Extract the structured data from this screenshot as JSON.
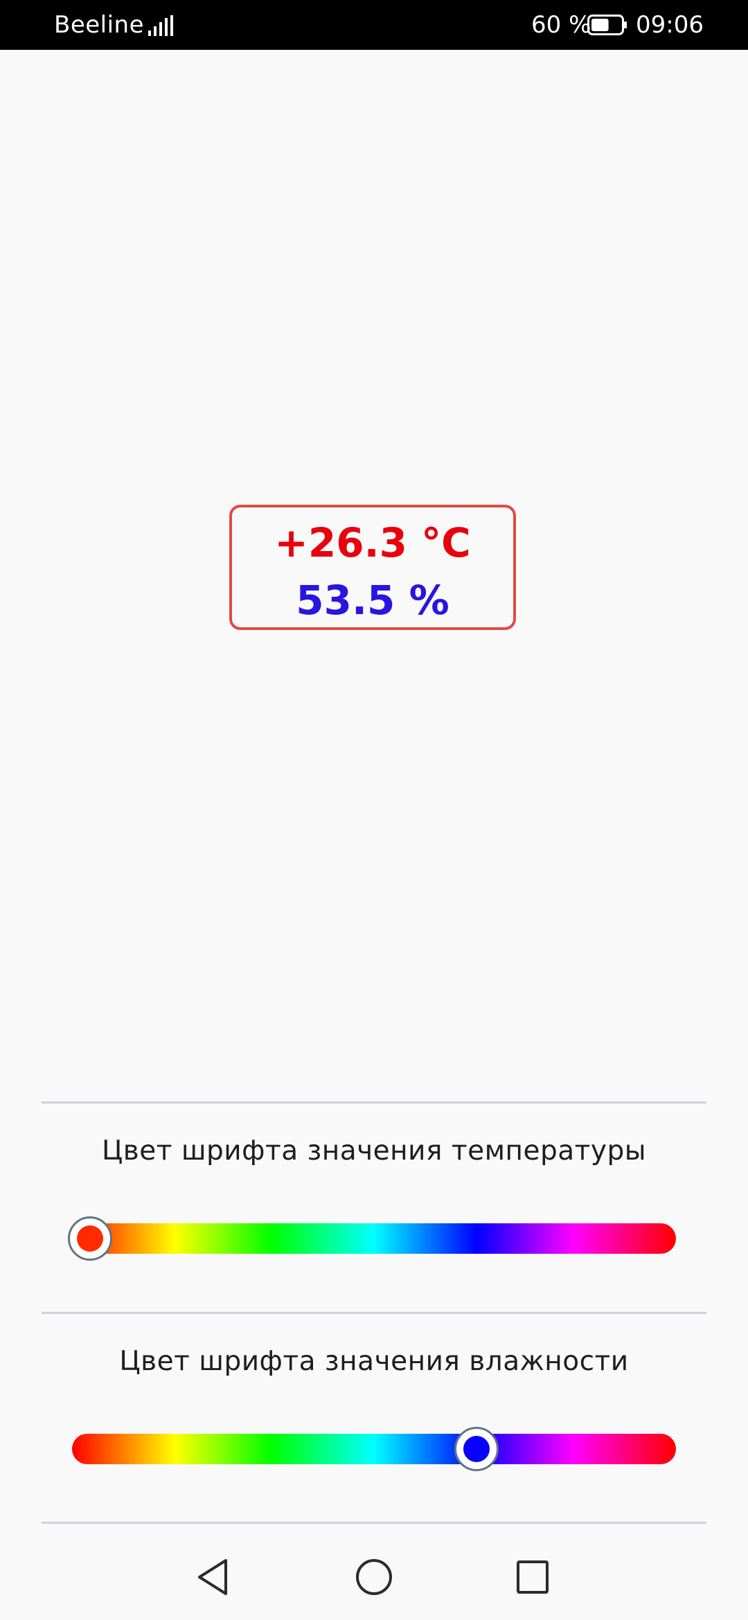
{
  "status_bar": {
    "carrier": "Beeline",
    "battery_percent": "60 %",
    "battery_level": 0.6,
    "time": "09:06",
    "icons": [
      "signal-icon",
      "battery-icon"
    ]
  },
  "readout": {
    "temperature": "+26.3 °C",
    "humidity": "53.5 %",
    "temperature_color": "#e8000c",
    "humidity_color": "#2a14e0",
    "border_color": "#e24a43"
  },
  "controls": {
    "temperature_color_label": "Цвет шрифта значения температуры",
    "temperature_slider_value": 0.03,
    "temperature_thumb_color": "#ff2a00",
    "humidity_color_label": "Цвет шрифта значения влажности",
    "humidity_slider_value": 0.67,
    "humidity_thumb_color": "#0a00ff"
  },
  "nav_bar": {
    "icons": [
      "back-icon",
      "home-icon",
      "recents-icon"
    ]
  }
}
